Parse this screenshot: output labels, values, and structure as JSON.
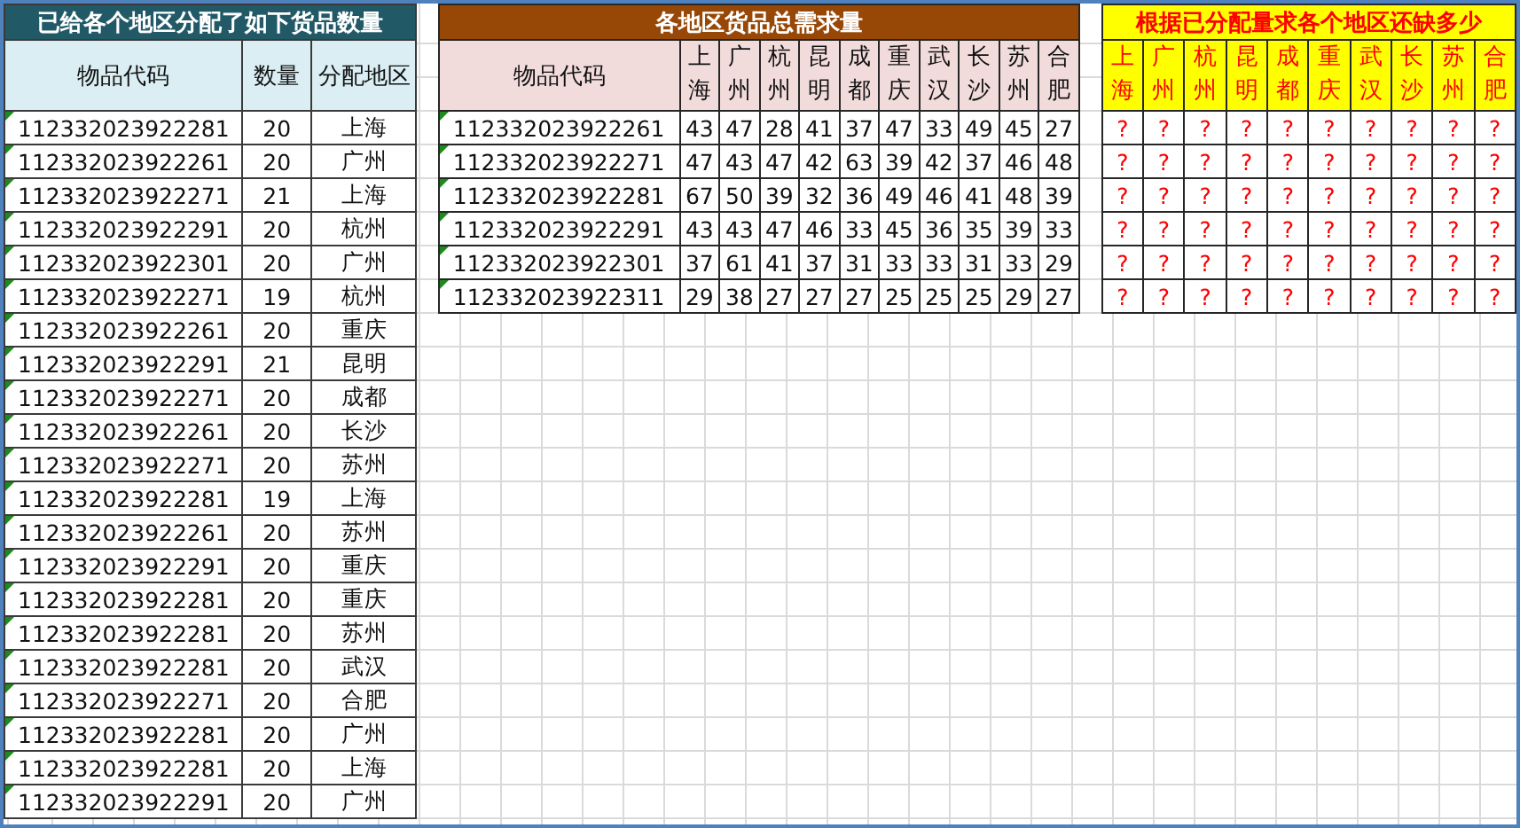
{
  "allocated": {
    "title": "已给各个地区分配了如下货品数量",
    "columns": [
      "物品代码",
      "数量",
      "分配地区"
    ],
    "rows": [
      {
        "code": "112332023922281",
        "qty": "20",
        "region": "上海",
        "flagged": true
      },
      {
        "code": "112332023922261",
        "qty": "20",
        "region": "广州",
        "flagged": true
      },
      {
        "code": "112332023922271",
        "qty": "21",
        "region": "上海",
        "flagged": true
      },
      {
        "code": "112332023922291",
        "qty": "20",
        "region": "杭州",
        "flagged": true
      },
      {
        "code": "112332023922301",
        "qty": "20",
        "region": "广州",
        "flagged": true
      },
      {
        "code": "112332023922271",
        "qty": "19",
        "region": "杭州",
        "flagged": true
      },
      {
        "code": "112332023922261",
        "qty": "20",
        "region": "重庆",
        "flagged": true
      },
      {
        "code": "112332023922291",
        "qty": "21",
        "region": "昆明",
        "flagged": true
      },
      {
        "code": "112332023922271",
        "qty": "20",
        "region": "成都",
        "flagged": true
      },
      {
        "code": "112332023922261",
        "qty": "20",
        "region": "长沙",
        "flagged": true
      },
      {
        "code": "112332023922271",
        "qty": "20",
        "region": "苏州",
        "flagged": true
      },
      {
        "code": "112332023922281",
        "qty": "19",
        "region": "上海",
        "flagged": true
      },
      {
        "code": "112332023922261",
        "qty": "20",
        "region": "苏州",
        "flagged": true
      },
      {
        "code": "112332023922291",
        "qty": "20",
        "region": "重庆",
        "flagged": true
      },
      {
        "code": "112332023922281",
        "qty": "20",
        "region": "重庆",
        "flagged": true
      },
      {
        "code": "112332023922281",
        "qty": "20",
        "region": "苏州",
        "flagged": true
      },
      {
        "code": "112332023922281",
        "qty": "20",
        "region": "武汉",
        "flagged": true
      },
      {
        "code": "112332023922271",
        "qty": "20",
        "region": "合肥",
        "flagged": true
      },
      {
        "code": "112332023922281",
        "qty": "20",
        "region": "广州",
        "flagged": true
      },
      {
        "code": "112332023922281",
        "qty": "20",
        "region": "上海",
        "flagged": true
      },
      {
        "code": "112332023922291",
        "qty": "20",
        "region": "广州",
        "flagged": true
      }
    ]
  },
  "demand": {
    "title": "各地区货品总需求量",
    "code_header": "物品代码",
    "regions": [
      "上海",
      "广州",
      "杭州",
      "昆明",
      "成都",
      "重庆",
      "武汉",
      "长沙",
      "苏州",
      "合肥"
    ],
    "rows": [
      {
        "code": "112332023922261",
        "values": [
          "43",
          "47",
          "28",
          "41",
          "37",
          "47",
          "33",
          "49",
          "45",
          "27"
        ],
        "flagged": true
      },
      {
        "code": "112332023922271",
        "values": [
          "47",
          "43",
          "47",
          "42",
          "63",
          "39",
          "42",
          "37",
          "46",
          "48"
        ],
        "flagged": true
      },
      {
        "code": "112332023922281",
        "values": [
          "67",
          "50",
          "39",
          "32",
          "36",
          "49",
          "46",
          "41",
          "48",
          "39"
        ],
        "flagged": true
      },
      {
        "code": "112332023922291",
        "values": [
          "43",
          "43",
          "47",
          "46",
          "33",
          "45",
          "36",
          "35",
          "39",
          "33"
        ],
        "flagged": true
      },
      {
        "code": "112332023922301",
        "values": [
          "37",
          "61",
          "41",
          "37",
          "31",
          "33",
          "33",
          "31",
          "33",
          "29"
        ],
        "flagged": true
      },
      {
        "code": "112332023922311",
        "values": [
          "29",
          "38",
          "27",
          "27",
          "27",
          "25",
          "25",
          "25",
          "29",
          "27"
        ],
        "flagged": true
      }
    ]
  },
  "shortage": {
    "title": "根据已分配量求各个地区还缺多少",
    "regions": [
      "上海",
      "广州",
      "杭州",
      "昆明",
      "成都",
      "重庆",
      "武汉",
      "长沙",
      "苏州",
      "合肥"
    ],
    "rows": [
      [
        "?",
        "?",
        "?",
        "?",
        "?",
        "?",
        "?",
        "?",
        "?",
        "?"
      ],
      [
        "?",
        "?",
        "?",
        "?",
        "?",
        "?",
        "?",
        "?",
        "?",
        "?"
      ],
      [
        "?",
        "?",
        "?",
        "?",
        "?",
        "?",
        "?",
        "?",
        "?",
        "?"
      ],
      [
        "?",
        "?",
        "?",
        "?",
        "?",
        "?",
        "?",
        "?",
        "?",
        "?"
      ],
      [
        "?",
        "?",
        "?",
        "?",
        "?",
        "?",
        "?",
        "?",
        "?",
        "?"
      ],
      [
        "?",
        "?",
        "?",
        "?",
        "?",
        "?",
        "?",
        "?",
        "?",
        "?"
      ]
    ]
  }
}
